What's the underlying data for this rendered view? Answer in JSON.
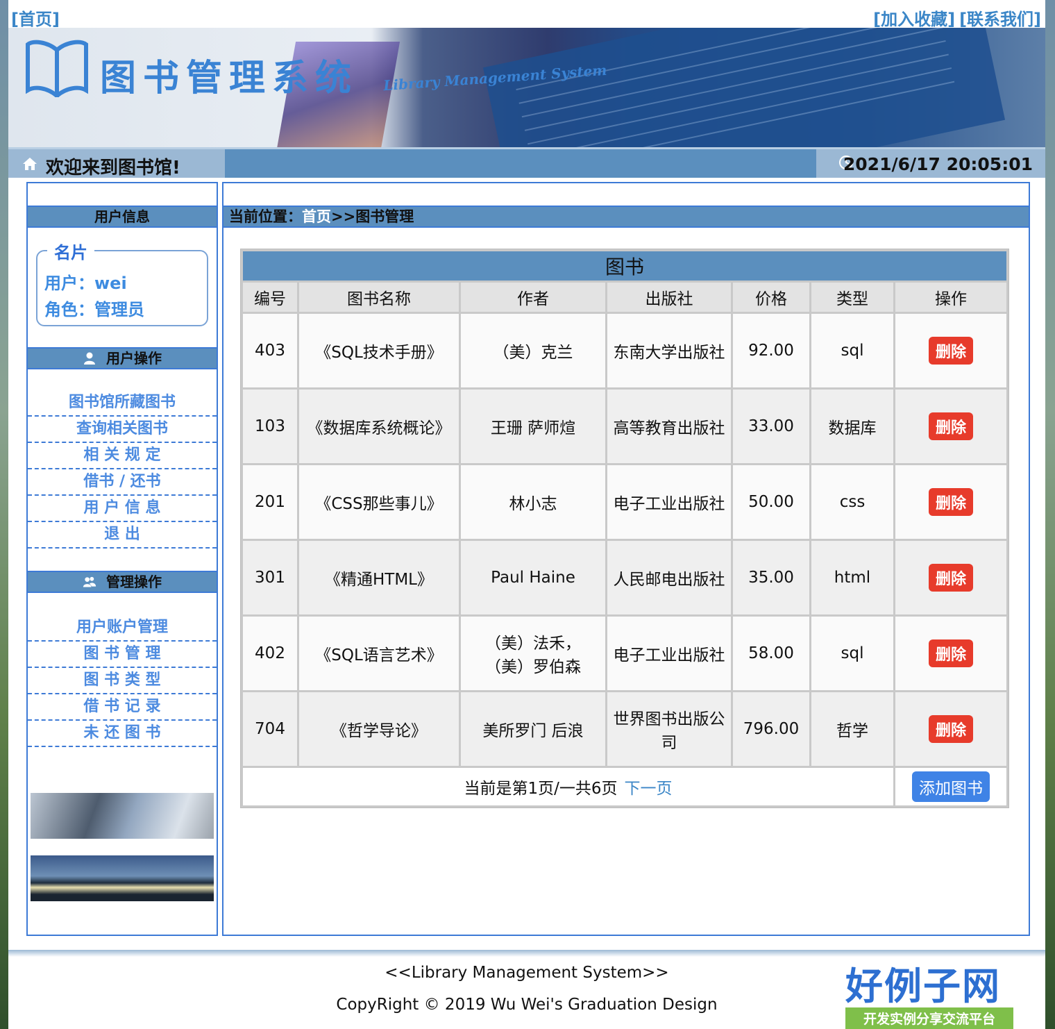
{
  "toplinks": {
    "home": "[首页]",
    "favorite": "[加入收藏]",
    "contact": "[联系我们]"
  },
  "banner": {
    "title_cn": "图书管理系统",
    "title_en": "Library Management System"
  },
  "welcome": {
    "message": "欢迎来到图书馆!",
    "datetime": "2021/6/17 20:05:01"
  },
  "sidebar": {
    "user_info_title": "用户信息",
    "card": {
      "legend": "名片",
      "user_line": "用户：wei",
      "role_line": "角色：管理员"
    },
    "user_ops_title": "用户操作",
    "user_ops": [
      "图书馆所藏图书",
      "查询相关图书",
      "相 关 规 定",
      "借书 / 还书",
      "用 户 信 息",
      "退  出"
    ],
    "admin_ops_title": "管理操作",
    "admin_ops": [
      "用户账户管理",
      "图 书 管 理",
      "图 书 类 型",
      "借 书 记 录",
      "未 还 图 书"
    ]
  },
  "main": {
    "breadcrumb_prefix": "当前位置：",
    "breadcrumb_home": "首页",
    "breadcrumb_current": ">>图书管理",
    "table_caption": "图书",
    "columns": [
      "编号",
      "图书名称",
      "作者",
      "出版社",
      "价格",
      "类型",
      "操作"
    ],
    "rows": [
      {
        "id": "403",
        "name": "《SQL技术手册》",
        "author": "（美）克兰",
        "publisher": "东南大学出版社",
        "price": "92.00",
        "type": "sql",
        "action": "删除"
      },
      {
        "id": "103",
        "name": "《数据库系统概论》",
        "author": "王珊 萨师煊",
        "publisher": "高等教育出版社",
        "price": "33.00",
        "type": "数据库",
        "action": "删除"
      },
      {
        "id": "201",
        "name": "《CSS那些事儿》",
        "author": "林小志",
        "publisher": "电子工业出版社",
        "price": "50.00",
        "type": "css",
        "action": "删除"
      },
      {
        "id": "301",
        "name": "《精通HTML》",
        "author": "Paul Haine",
        "publisher": "人民邮电出版社",
        "price": "35.00",
        "type": "html",
        "action": "删除"
      },
      {
        "id": "402",
        "name": "《SQL语言艺术》",
        "author": "（美）法禾，（美）罗伯森",
        "publisher": "电子工业出版社",
        "price": "58.00",
        "type": "sql",
        "action": "删除"
      },
      {
        "id": "704",
        "name": "《哲学导论》",
        "author": "美所罗门 后浪",
        "publisher": "世界图书出版公司",
        "price": "796.00",
        "type": "哲学",
        "action": "删除"
      }
    ],
    "pager_text": "当前是第1页/一共6页",
    "next_page": "下一页",
    "add_button": "添加图书"
  },
  "footer": {
    "line1": "<<Library Management System>>",
    "line2": "CopyRight © 2019  Wu Wei's Graduation Design"
  },
  "watermark": {
    "logo_big": "好例子网",
    "logo_small": "开发实例分享交流平台"
  },
  "colors": {
    "accent_blue": "#5b8fbe",
    "border_blue": "#3d7ad6",
    "delete_red": "#e73b2b",
    "add_blue": "#3f83e6"
  }
}
